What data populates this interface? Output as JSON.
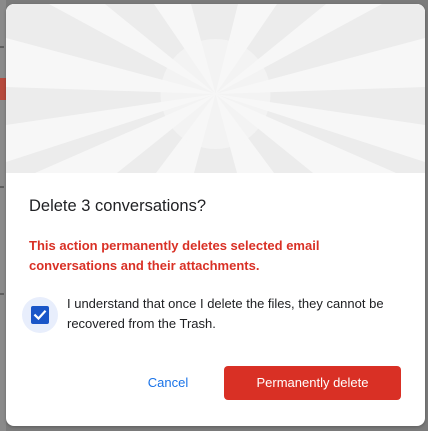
{
  "dialog": {
    "title": "Delete 3 conversations?",
    "warning": "This action permanently deletes selected email conversations and their attachments.",
    "confirmation": {
      "checked": true,
      "text": "I understand that once I delete the files, they cannot be recovered from the Trash."
    },
    "actions": {
      "cancel": "Cancel",
      "delete": "Permanently delete"
    }
  },
  "colors": {
    "danger": "#d93025",
    "primary": "#1a73e8",
    "checkbox": "#1a56c8",
    "text": "#202124",
    "hero": "#f2f2f2"
  },
  "icons": {
    "hero": "radial-burst-illustration",
    "checkbox": "check-icon"
  }
}
